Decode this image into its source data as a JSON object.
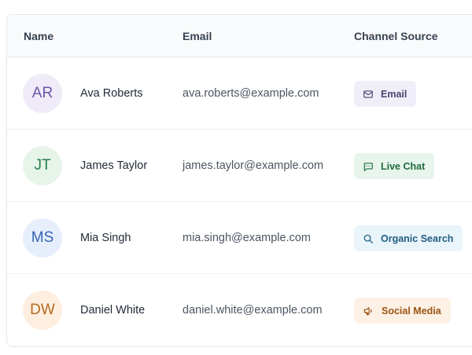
{
  "table": {
    "headers": {
      "name": "Name",
      "email": "Email",
      "channel": "Channel Source"
    },
    "rows": [
      {
        "initials": "AR",
        "name": "Ava Roberts",
        "email": "ava.roberts@example.com",
        "channel": "Email",
        "channel_icon": "mail-icon",
        "avatar_bg": "#efebf8",
        "avatar_fg": "#6b56a8",
        "badge_bg": "#f0eef8",
        "badge_fg": "#4a4470"
      },
      {
        "initials": "JT",
        "name": "James Taylor",
        "email": "james.taylor@example.com",
        "channel": "Live Chat",
        "channel_icon": "chat-icon",
        "avatar_bg": "#e6f4ea",
        "avatar_fg": "#2a7d4a",
        "badge_bg": "#e7f5ec",
        "badge_fg": "#1e6b3c"
      },
      {
        "initials": "MS",
        "name": "Mia Singh",
        "email": "mia.singh@example.com",
        "channel": "Organic Search",
        "channel_icon": "search-icon",
        "avatar_bg": "#e6eefb",
        "avatar_fg": "#3464b4",
        "badge_bg": "#eaf4fb",
        "badge_fg": "#1f5e80"
      },
      {
        "initials": "DW",
        "name": "Daniel White",
        "email": "daniel.white@example.com",
        "channel": "Social Media",
        "channel_icon": "megaphone-icon",
        "avatar_bg": "#fdeee0",
        "avatar_fg": "#b46a1e",
        "badge_bg": "#fdf1e6",
        "badge_fg": "#9a5512"
      }
    ]
  }
}
